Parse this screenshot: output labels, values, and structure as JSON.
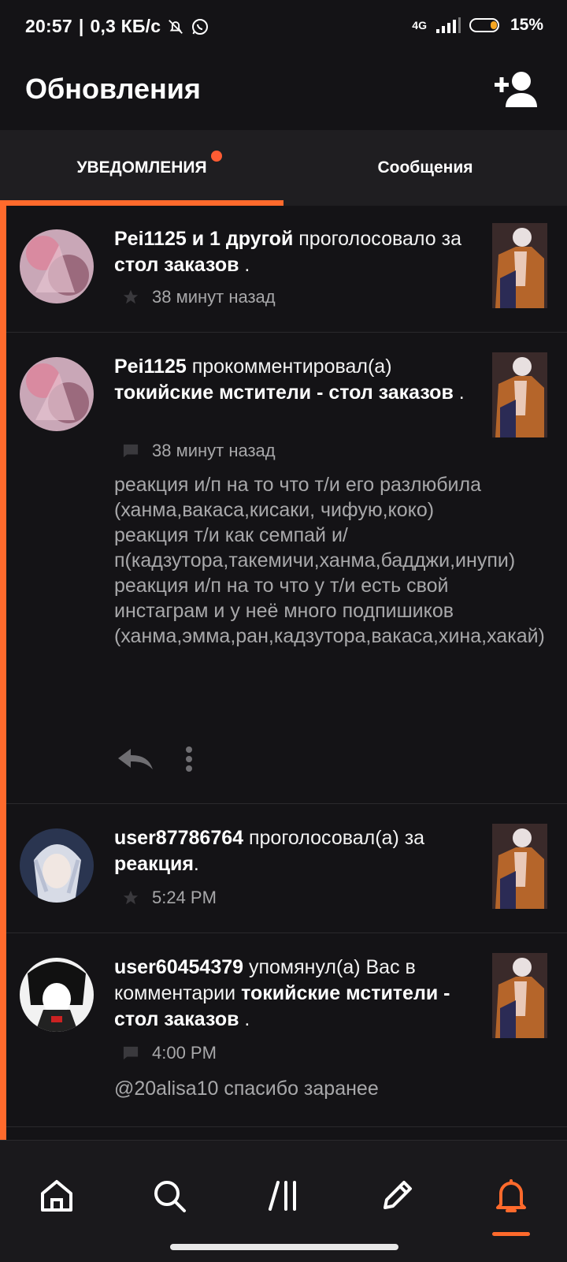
{
  "status_bar": {
    "time": "20:57",
    "speed": "0,3 КБ/с",
    "network": "4G",
    "battery": "15%"
  },
  "header": {
    "title": "Обновления"
  },
  "tabs": [
    {
      "label": "УВЕДОМЛЕНИЯ",
      "active": true,
      "has_badge": true
    },
    {
      "label": "Сообщения",
      "active": false
    }
  ],
  "notifications": [
    {
      "user": "Pei1125 и 1 другой",
      "action": " проголосовало за ",
      "target": "стол заказов",
      "suffix": " .",
      "time": "38 минут назад",
      "meta_icon": "star-icon"
    },
    {
      "user": "Pei1125",
      "action": " прокомментировал(а) ",
      "target": "токийские мстители - стол заказов",
      "suffix": " .",
      "time": "38 минут назад",
      "meta_icon": "comment-icon",
      "comment": "реакция и/п на то что т/и его разлюбила (ханма,вакаса,кисаки, чифую,коко)\nреакция т/и как семпай и/п(кадзутора,такемичи,ханма,бадджи,инупи)\nреакция и/п  на то что у т/и есть свой инстаграм и у неё много подпишиков (ханма,эмма,ран,кадзутора,вакаса,хина,хакай)"
    },
    {
      "user": "user87786764",
      "action": " проголосовал(а) за ",
      "target": "реакция",
      "suffix": ".",
      "time": "5:24 PM",
      "meta_icon": "star-icon"
    },
    {
      "user": "user60454379",
      "action": " упомянул(а) Вас в комментарии ",
      "target": "токийские мстители - стол заказов",
      "suffix": " .",
      "time": "4:00 PM",
      "meta_icon": "comment-icon",
      "comment": "@20alisa10 спасибо заранее"
    }
  ],
  "bottom_nav": [
    {
      "name": "home",
      "icon": "home-icon"
    },
    {
      "name": "search",
      "icon": "search-icon"
    },
    {
      "name": "library",
      "icon": "library-icon"
    },
    {
      "name": "write",
      "icon": "pencil-icon"
    },
    {
      "name": "notifications",
      "icon": "bell-icon",
      "active": true
    }
  ],
  "colors": {
    "accent": "#ff6a2c",
    "background": "#141316",
    "muted_text": "#a8a8aa"
  }
}
